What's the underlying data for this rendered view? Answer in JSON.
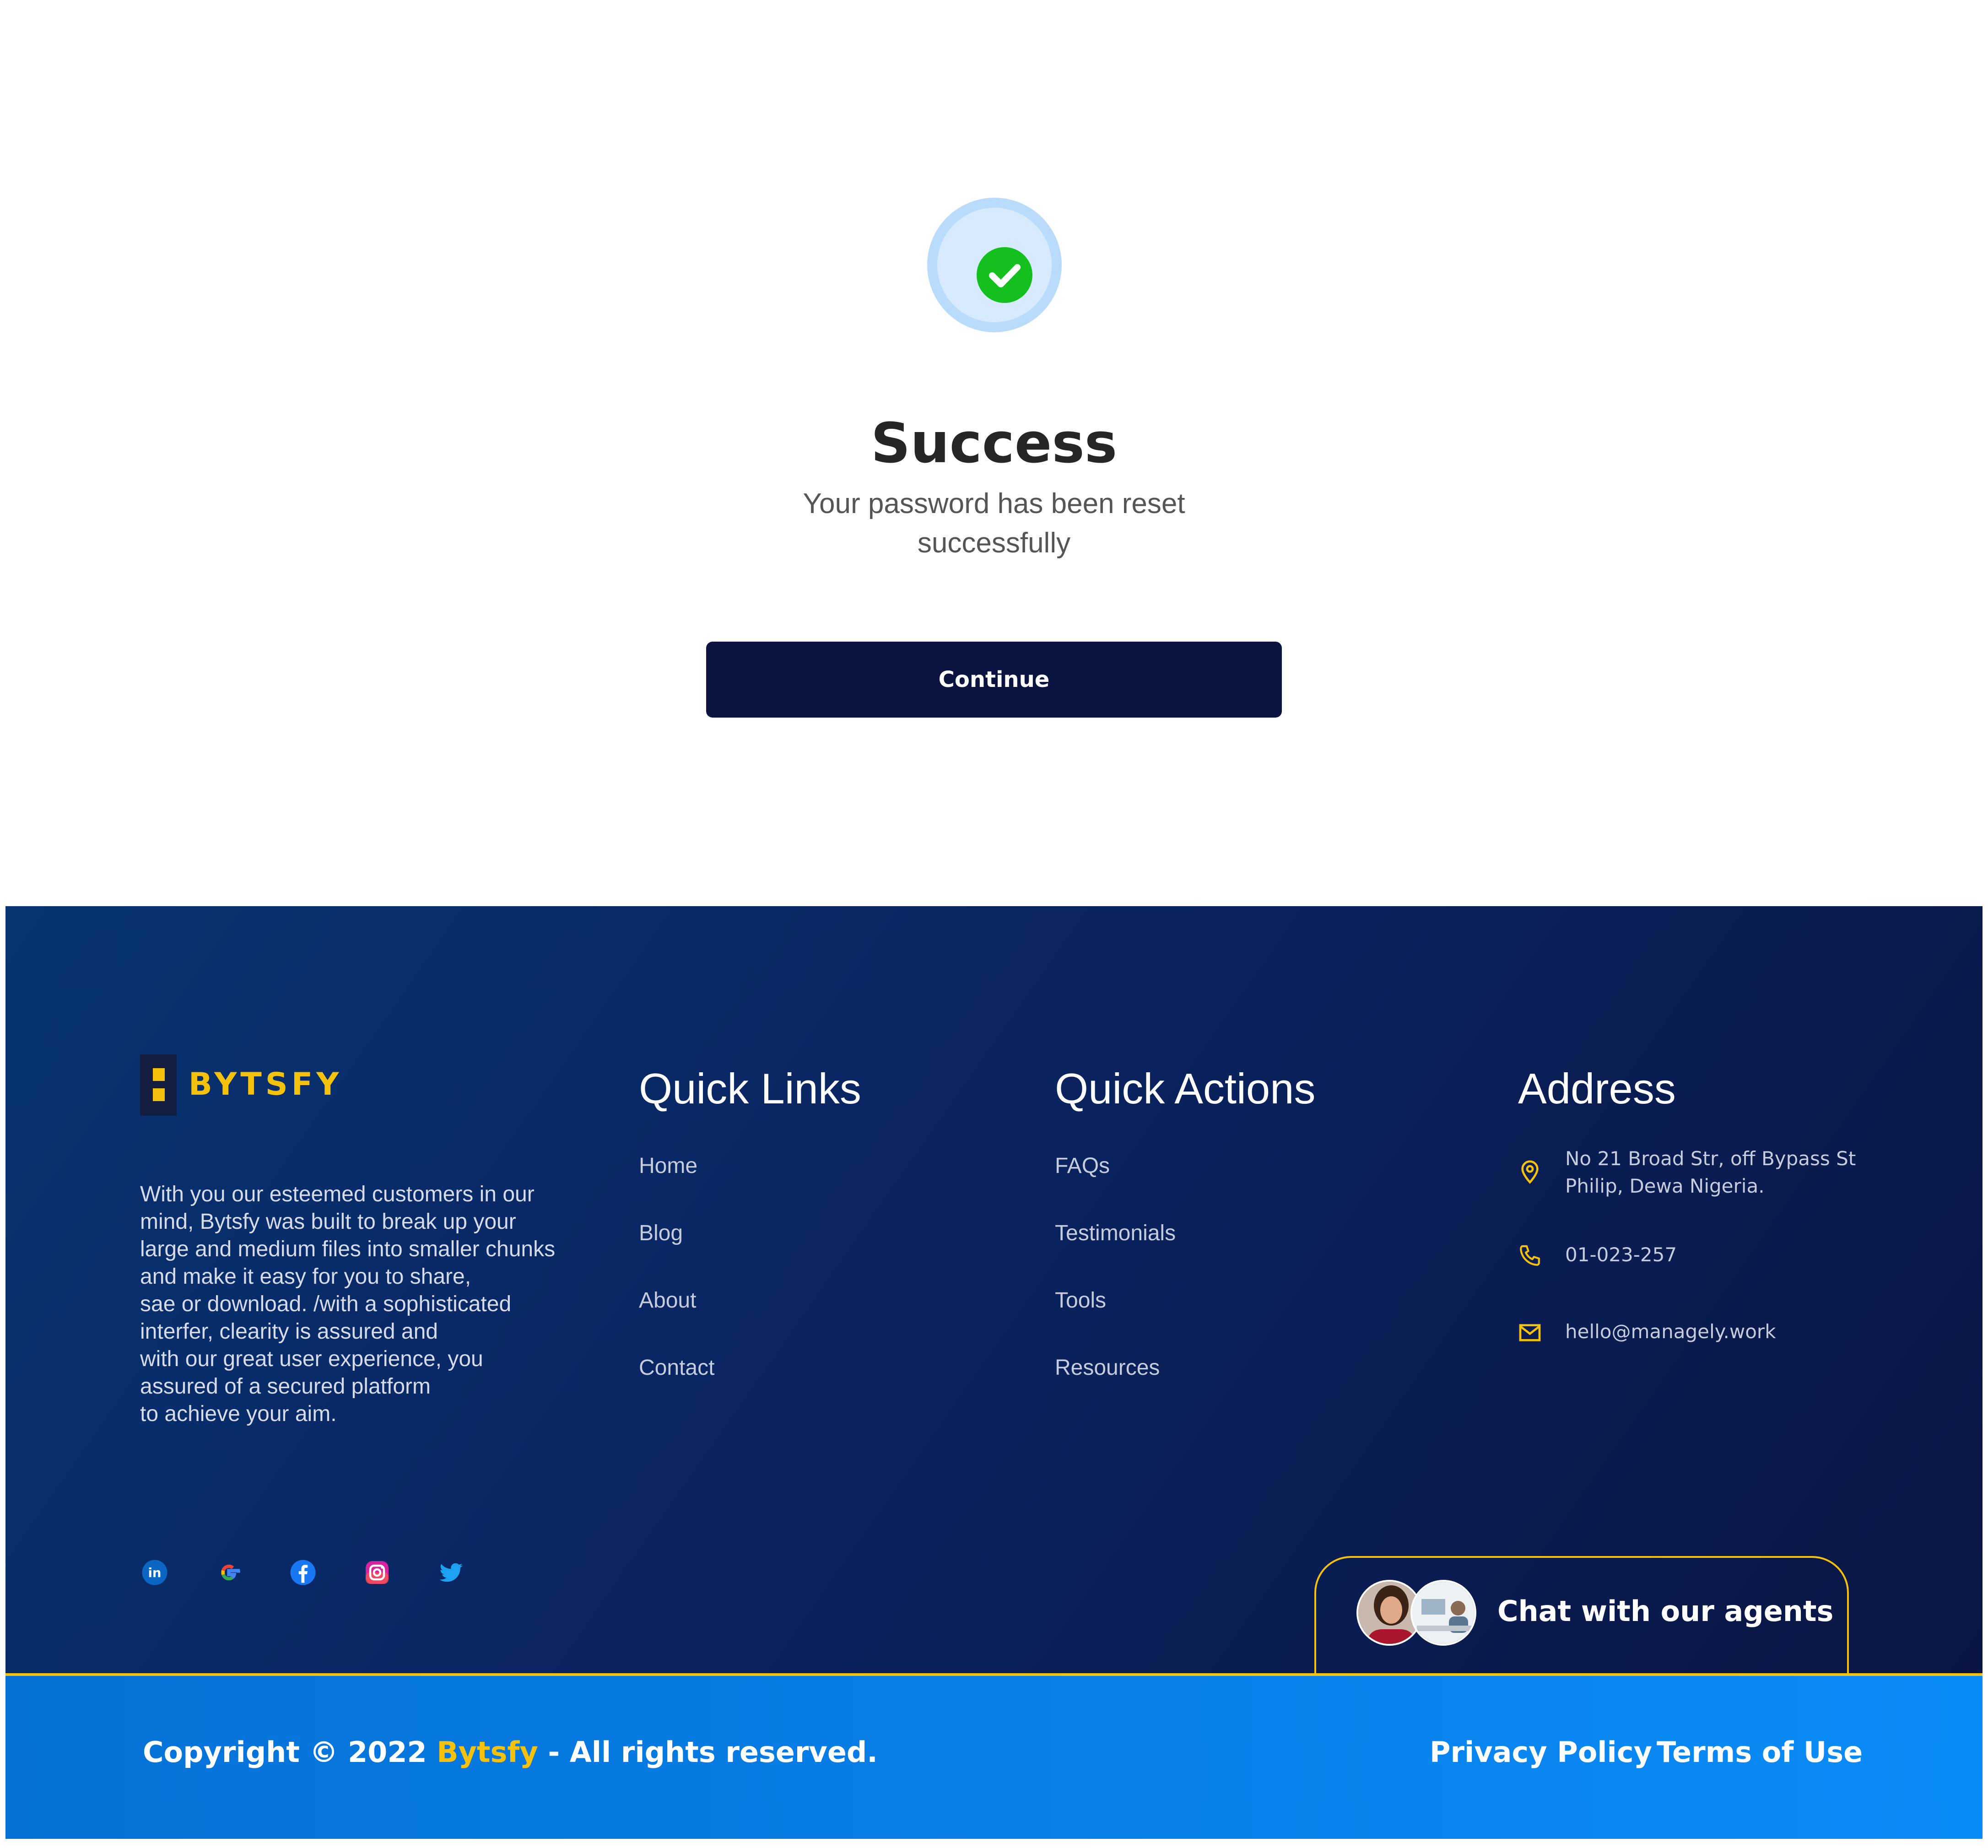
{
  "success": {
    "title": "Success",
    "message_line1": "Your password has been reset",
    "message_line2": "successfully",
    "continue_label": "Continue",
    "icon": "check-circle-icon"
  },
  "footer": {
    "brand": "BYTSFY",
    "about_lines": [
      "With you our esteemed customers in our",
      "mind, Bytsfy was built to break up your",
      "large and medium files into smaller chunks",
      "and make it easy for you to share,",
      "sae or download. /with a sophisticated",
      "interfer, clearity is assured and",
      "with our great user experience, you",
      "assured of a secured platform",
      "to achieve your aim."
    ],
    "quick_links": {
      "title": "Quick Links",
      "items": [
        "Home",
        "Blog",
        "About",
        "Contact"
      ]
    },
    "quick_actions": {
      "title": "Quick Actions",
      "items": [
        "FAQs",
        "Testimonials",
        "Tools",
        "Resources"
      ]
    },
    "address": {
      "title": "Address",
      "street_line1": "No 21 Broad Str, off Bypass St",
      "street_line2": "Philip, Dewa Nigeria.",
      "phone": "01-023-257",
      "email": "hello@managely.work"
    },
    "social": [
      "linkedin-icon",
      "google-icon",
      "facebook-icon",
      "instagram-icon",
      "twitter-icon"
    ],
    "chat_label": "Chat with our agents"
  },
  "bottom_bar": {
    "copyright_prefix": "Copyright © 2022 ",
    "copyright_brand": "Bytsfy",
    "copyright_suffix": " - All rights reserved.",
    "privacy": "Privacy Policy",
    "terms": "Terms of Use"
  },
  "colors": {
    "accent": "#f4c20d",
    "button": "#0b1340",
    "success_green": "#13c01d",
    "footer_dark": "#0a1543",
    "bottom_blue": "#0a8cf8"
  }
}
